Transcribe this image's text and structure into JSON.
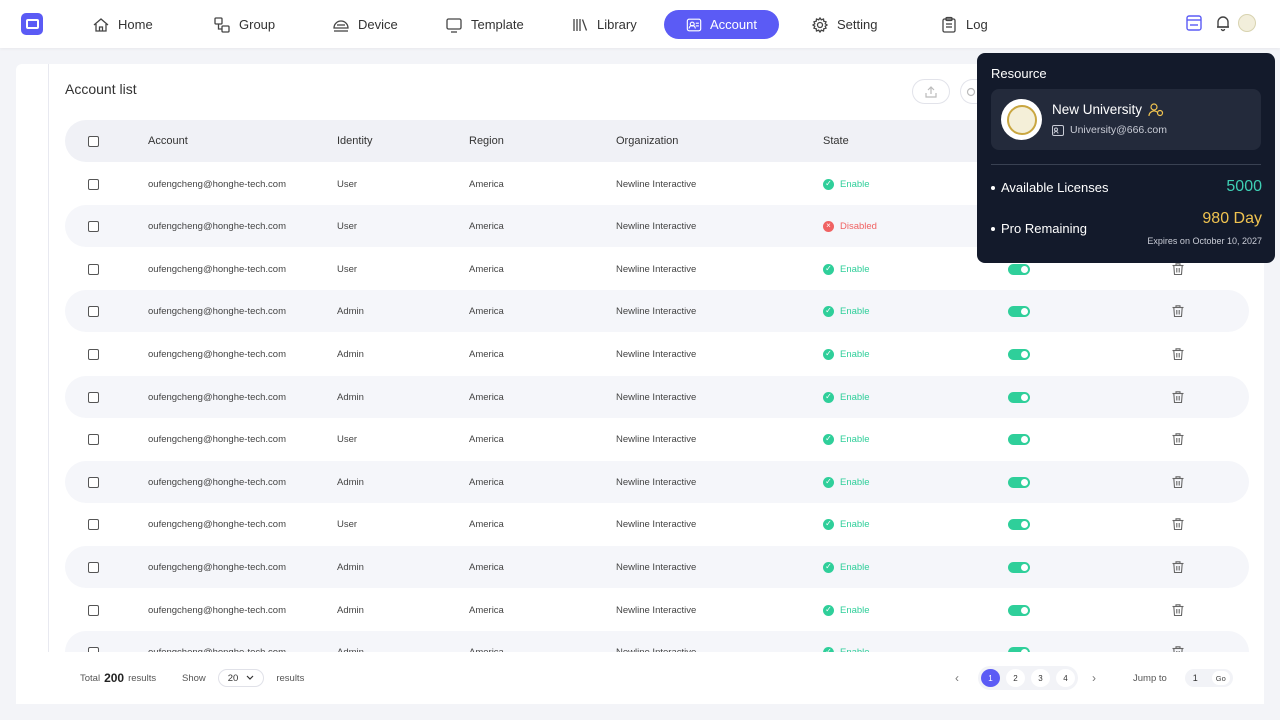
{
  "nav": {
    "items": [
      {
        "label": "Home",
        "icon": "home-icon"
      },
      {
        "label": "Group",
        "icon": "group-icon"
      },
      {
        "label": "Device",
        "icon": "device-icon"
      },
      {
        "label": "Template",
        "icon": "template-icon"
      },
      {
        "label": "Library",
        "icon": "library-icon"
      },
      {
        "label": "Account",
        "icon": "account-icon",
        "active": true
      },
      {
        "label": "Setting",
        "icon": "gear-icon"
      },
      {
        "label": "Log",
        "icon": "log-icon"
      }
    ],
    "accent": "#5b5bf5"
  },
  "page": {
    "title": "Account list"
  },
  "table": {
    "headers": {
      "account": "Account",
      "identity": "Identity",
      "region": "Region",
      "organization": "Organization",
      "state": "State"
    },
    "rows": [
      {
        "account": "oufengcheng@honghe-tech.com",
        "identity": "User",
        "region": "America",
        "organization": "Newline Interactive",
        "state": "Enable"
      },
      {
        "account": "oufengcheng@honghe-tech.com",
        "identity": "User",
        "region": "America",
        "organization": "Newline Interactive",
        "state": "Disabled"
      },
      {
        "account": "oufengcheng@honghe-tech.com",
        "identity": "User",
        "region": "America",
        "organization": "Newline Interactive",
        "state": "Enable"
      },
      {
        "account": "oufengcheng@honghe-tech.com",
        "identity": "Admin",
        "region": "America",
        "organization": "Newline Interactive",
        "state": "Enable"
      },
      {
        "account": "oufengcheng@honghe-tech.com",
        "identity": "Admin",
        "region": "America",
        "organization": "Newline Interactive",
        "state": "Enable"
      },
      {
        "account": "oufengcheng@honghe-tech.com",
        "identity": "Admin",
        "region": "America",
        "organization": "Newline Interactive",
        "state": "Enable"
      },
      {
        "account": "oufengcheng@honghe-tech.com",
        "identity": "User",
        "region": "America",
        "organization": "Newline Interactive",
        "state": "Enable"
      },
      {
        "account": "oufengcheng@honghe-tech.com",
        "identity": "Admin",
        "region": "America",
        "organization": "Newline Interactive",
        "state": "Enable"
      },
      {
        "account": "oufengcheng@honghe-tech.com",
        "identity": "User",
        "region": "America",
        "organization": "Newline Interactive",
        "state": "Enable"
      },
      {
        "account": "oufengcheng@honghe-tech.com",
        "identity": "Admin",
        "region": "America",
        "organization": "Newline Interactive",
        "state": "Enable"
      },
      {
        "account": "oufengcheng@honghe-tech.com",
        "identity": "Admin",
        "region": "America",
        "organization": "Newline Interactive",
        "state": "Enable"
      },
      {
        "account": "oufengcheng@honghe-tech.com",
        "identity": "Admin",
        "region": "America",
        "organization": "Newline Interactive",
        "state": "Enable"
      }
    ],
    "colors": {
      "enable": "#2fcf9a",
      "disabled": "#f06262"
    }
  },
  "footer": {
    "total_prefix": "Total",
    "total_count": "200",
    "total_suffix": "results",
    "show_label": "Show",
    "page_size": "20",
    "show_suffix": "results",
    "pages": [
      "1",
      "2",
      "3",
      "4"
    ],
    "current_page": "1",
    "jump_label": "Jump to",
    "jump_value": "1",
    "go_label": "Go"
  },
  "resource": {
    "title": "Resource",
    "org_name": "New University",
    "org_email": "University@666.com",
    "licenses_label": "Available Licenses",
    "licenses_value": "5000",
    "pro_label": "Pro Remaining",
    "pro_value": "980 Day",
    "expires": "Expires on October 10, 2027",
    "licenses_color": "#3ecfb4",
    "pro_color": "#f0c350"
  }
}
